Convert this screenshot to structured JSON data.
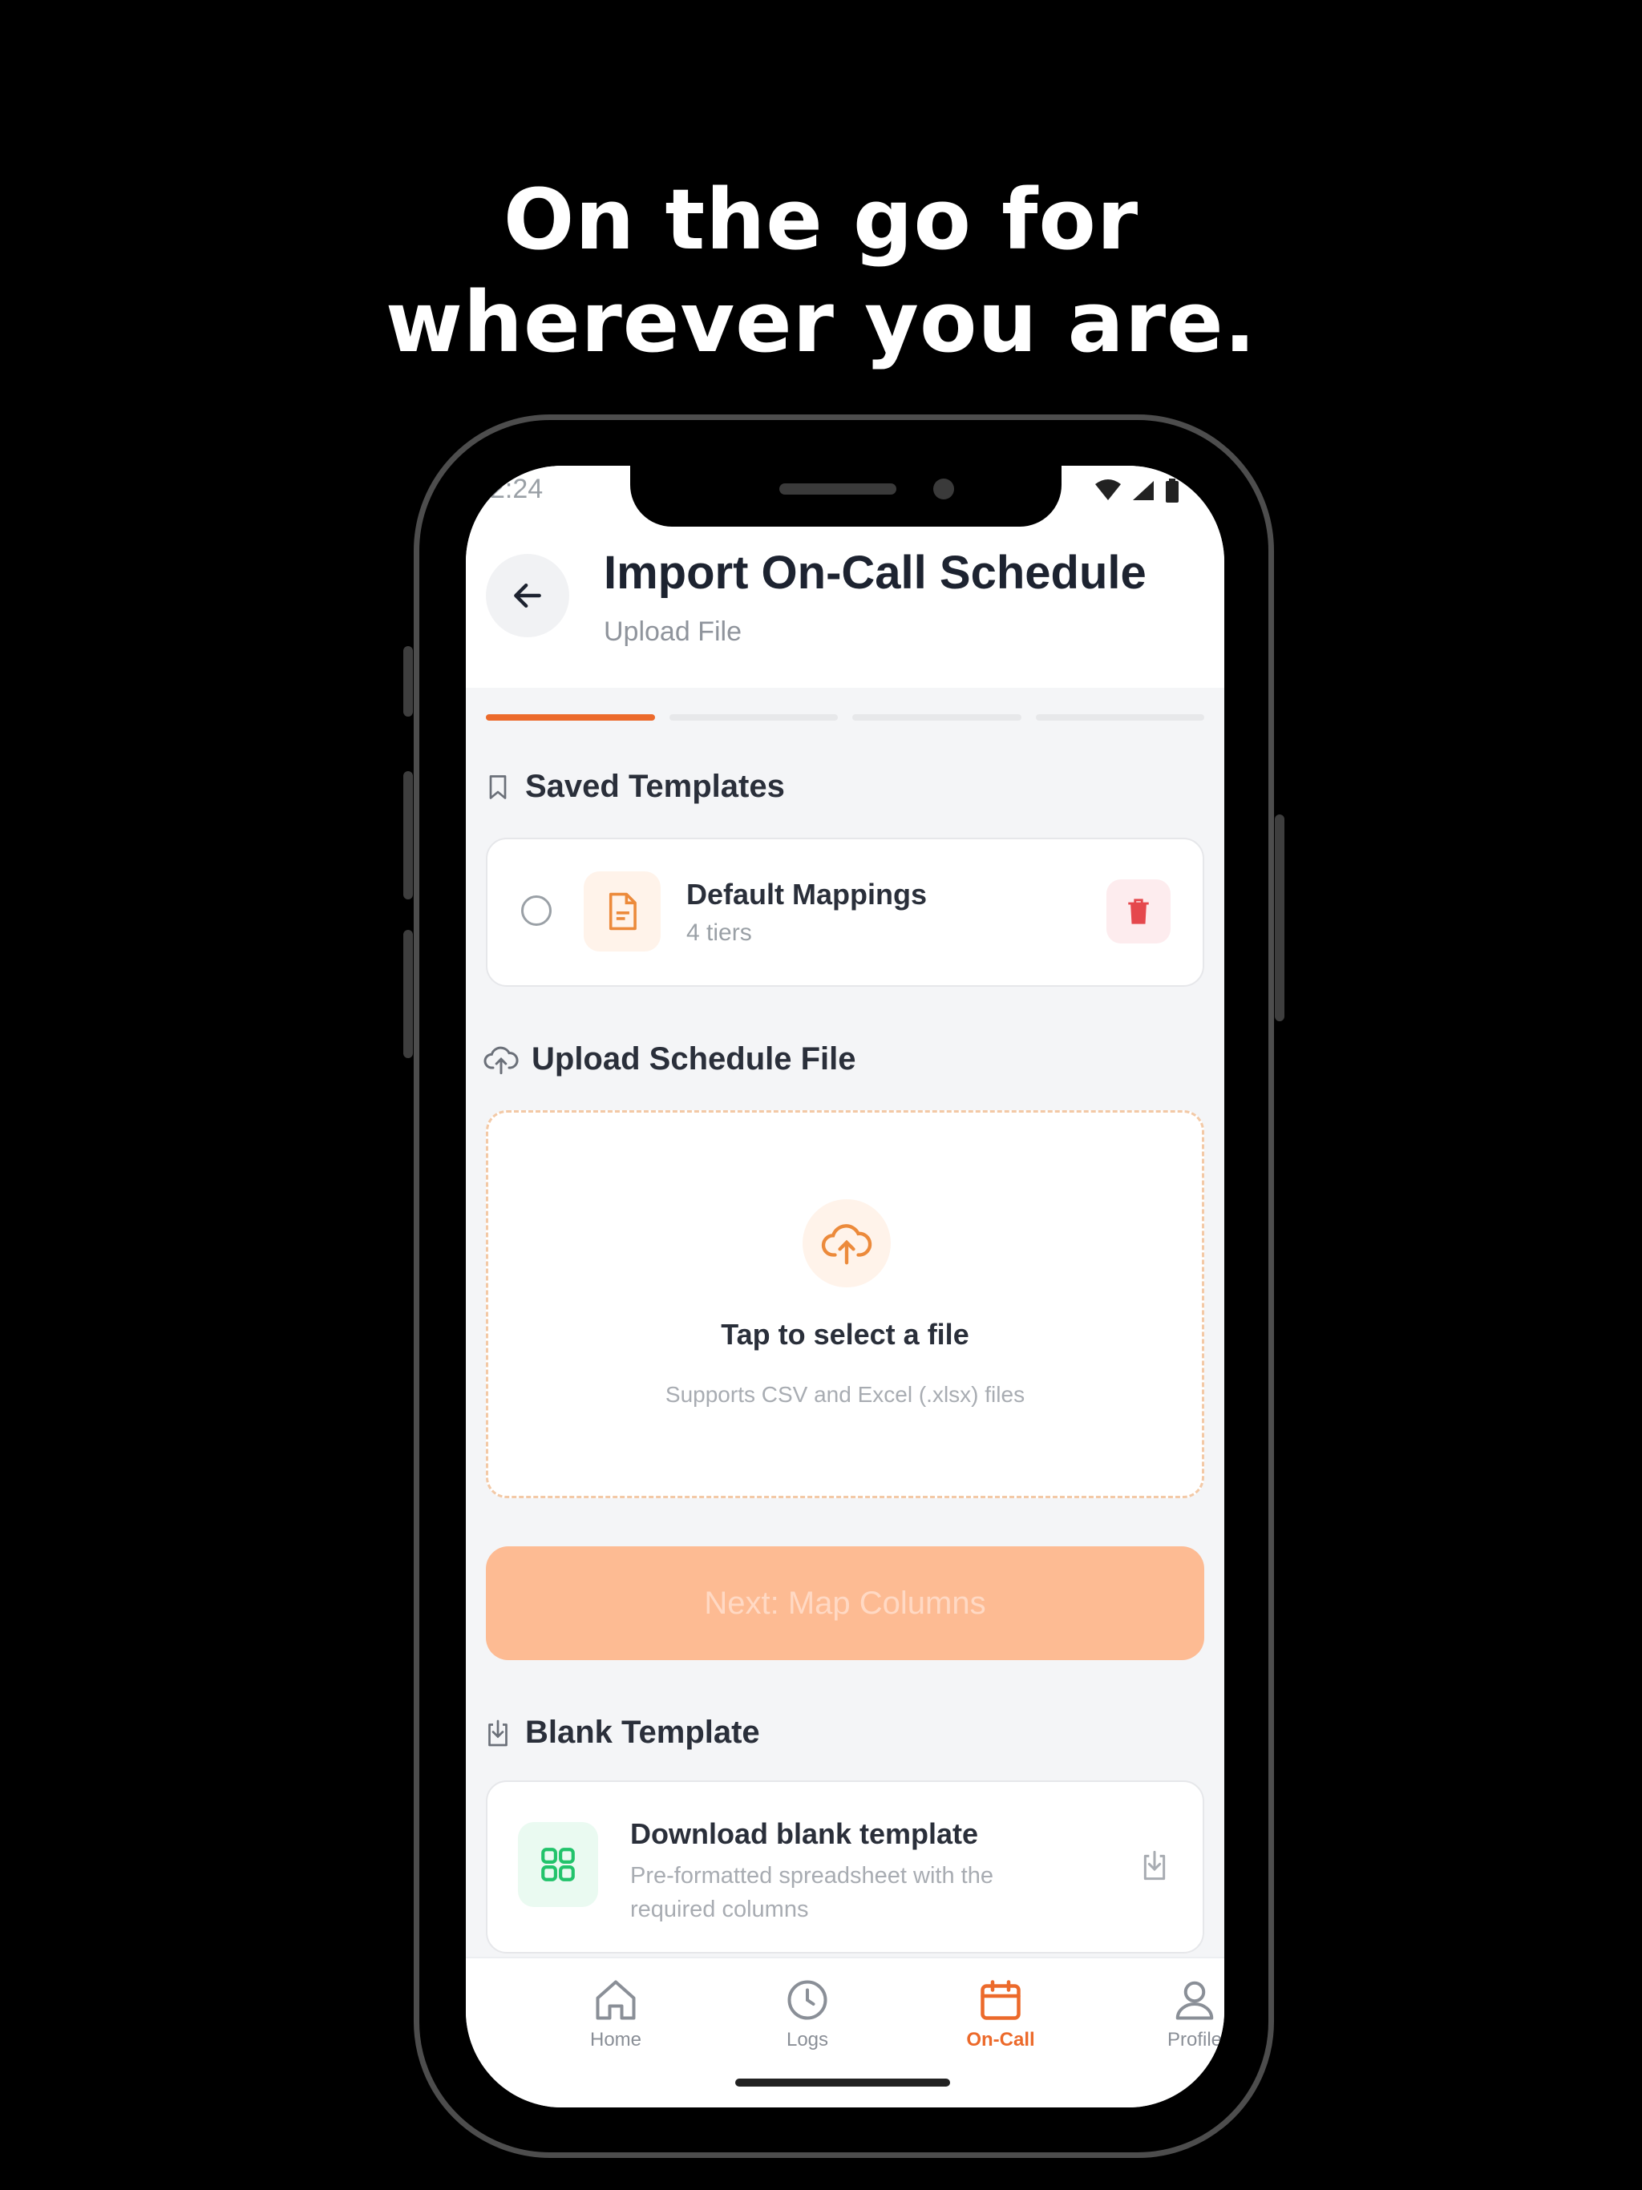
{
  "headline": {
    "line1": "On the go for",
    "line2": "wherever you are."
  },
  "status_bar": {
    "time": "2:24",
    "icons": [
      "wifi-icon",
      "signal-icon",
      "battery-icon"
    ]
  },
  "header": {
    "title": "Import On-Call Schedule",
    "subtitle": "Upload File"
  },
  "progress": {
    "steps_total": 4,
    "current_step": 1
  },
  "saved_templates": {
    "heading": "Saved Templates",
    "items": [
      {
        "name": "Default Mappings",
        "detail": "4 tiers"
      }
    ]
  },
  "upload": {
    "heading": "Upload Schedule File",
    "tap_text": "Tap to select a file",
    "supports_text": "Supports CSV and Excel (.xlsx) files"
  },
  "next_button": {
    "label": "Next: Map Columns"
  },
  "blank_template": {
    "heading": "Blank Template",
    "title": "Download blank template",
    "description": "Pre-formatted spreadsheet with the required columns"
  },
  "tabs": [
    {
      "label": "Home",
      "icon": "home-icon"
    },
    {
      "label": "Logs",
      "icon": "clock-icon"
    },
    {
      "label": "On-Call",
      "icon": "calendar-icon",
      "active": true
    },
    {
      "label": "Profile",
      "icon": "user-icon"
    }
  ],
  "colors": {
    "accent": "#ec6a2b",
    "accent_disabled": "#fdbb93",
    "danger": "#e5484d",
    "success": "#22c36b"
  }
}
